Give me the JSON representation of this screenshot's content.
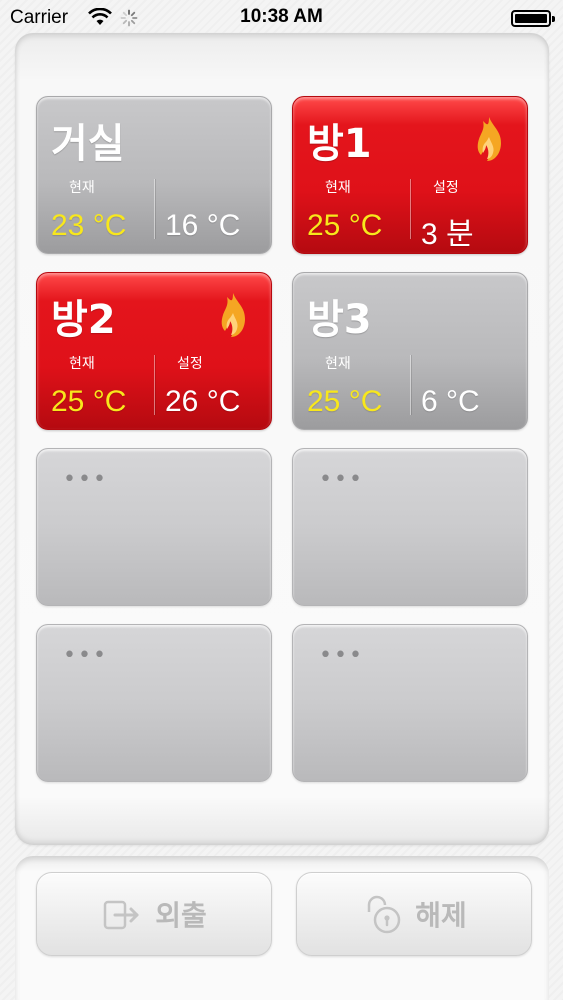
{
  "status_bar": {
    "carrier": "Carrier",
    "time": "10:38 AM"
  },
  "rooms": [
    {
      "name": "거실",
      "active": false,
      "current_label": "현재",
      "setting_label": "",
      "current": "23 °C",
      "setting": "16 °C"
    },
    {
      "name": "방1",
      "active": true,
      "current_label": "현재",
      "setting_label": "설정",
      "current": "25 °C",
      "setting": "3 분"
    },
    {
      "name": "방2",
      "active": true,
      "current_label": "현재",
      "setting_label": "설정",
      "current": "25 °C",
      "setting": "26 °C"
    },
    {
      "name": "방3",
      "active": false,
      "current_label": "현재",
      "setting_label": "",
      "current": "25 °C",
      "setting": "6 °C"
    }
  ],
  "empty_slots": [
    "•••",
    "•••",
    "•••",
    "•••"
  ],
  "buttons": {
    "away": "외출",
    "release": "해제"
  },
  "colors": {
    "active": "#e0121a",
    "inactive": "#b9b9bb",
    "current_temp": "#f8e71c"
  },
  "icons": {
    "flame": "flame-icon",
    "away": "exit-door-icon",
    "release": "unlock-icon"
  }
}
